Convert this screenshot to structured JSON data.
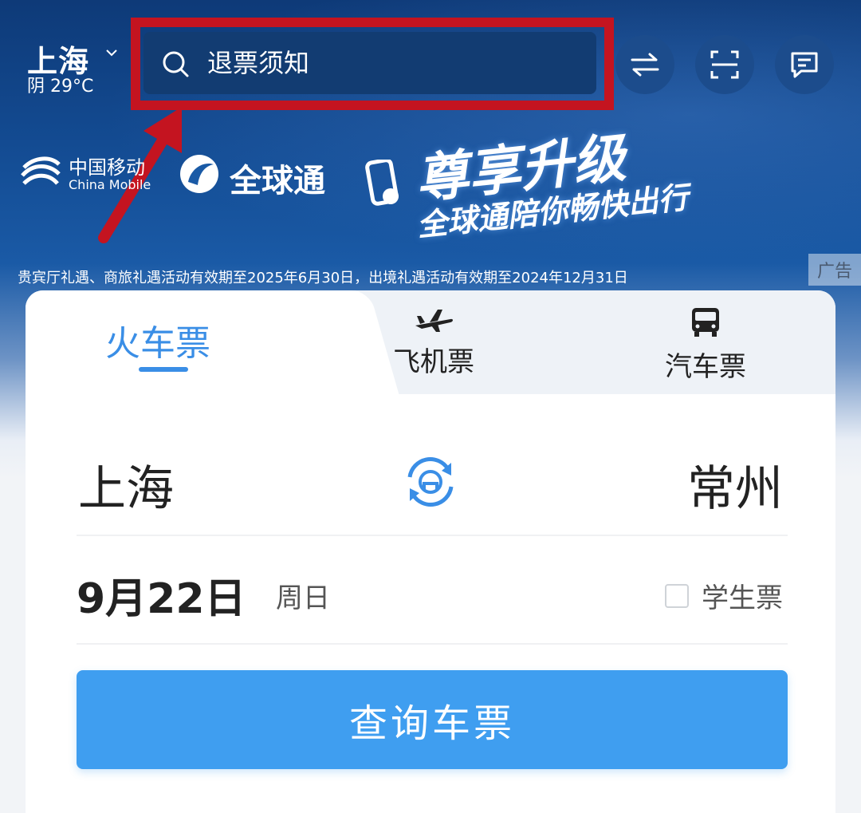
{
  "header": {
    "city": "上海",
    "weather": "阴 29°C",
    "search_text": "退票须知"
  },
  "banner": {
    "china_mobile_cn": "中国移动",
    "china_mobile_en": "China Mobile",
    "brand": "全球通",
    "slogan_main": "尊享升级",
    "slogan_sub": "全球通陪你畅快出行",
    "disclaimer": "贵宾厅礼遇、商旅礼遇活动有效期至2025年6月30日，出境礼遇活动有效期至2024年12月31日",
    "ad_tag": "广告"
  },
  "tabs": [
    {
      "label": "火车票",
      "active": true
    },
    {
      "label": "飞机票",
      "icon": "airplane-icon"
    },
    {
      "label": "汽车票",
      "icon": "bus-icon"
    }
  ],
  "route": {
    "from": "上海",
    "to": "常州"
  },
  "date": {
    "value": "9月22日",
    "weekday": "周日"
  },
  "student_ticket_label": "学生票",
  "query_button": "查询车票",
  "colors": {
    "accent": "#3a8ee6",
    "button": "#3f9ef0",
    "highlight": "#c41420"
  }
}
